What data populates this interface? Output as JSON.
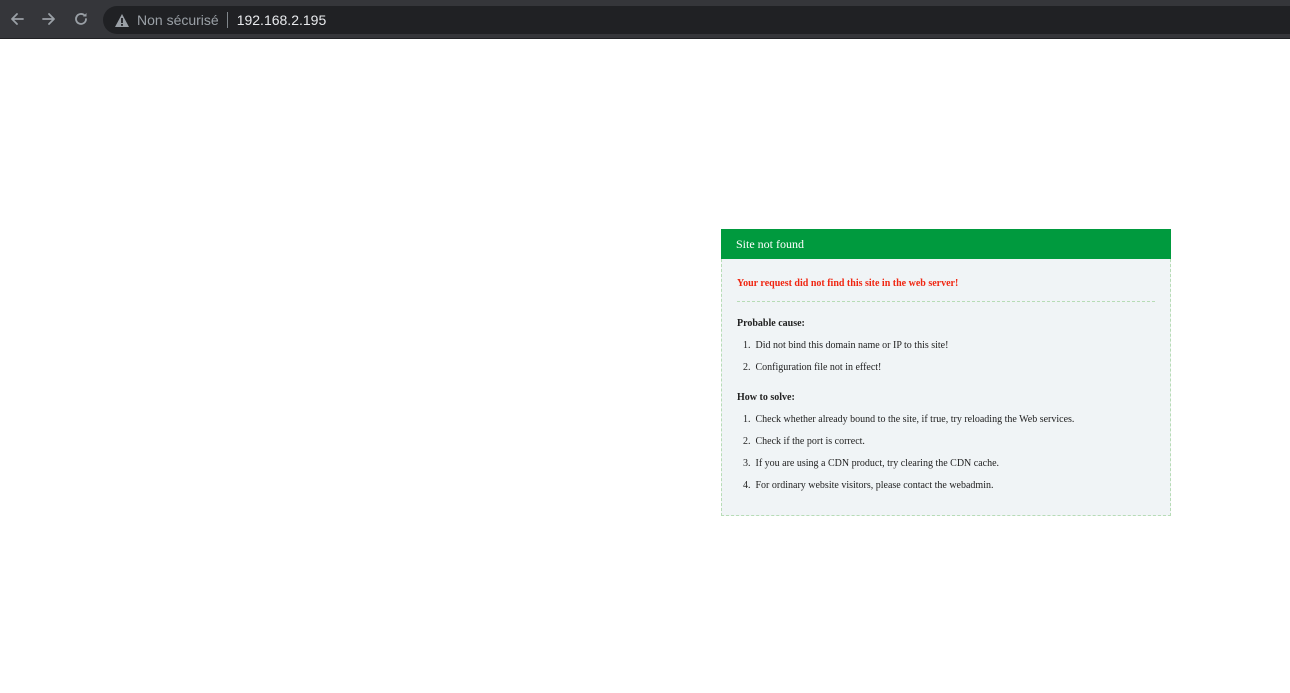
{
  "browser": {
    "security_label": "Non sécurisé",
    "url": "192.168.2.195",
    "icons": {
      "back": "arrow-left-icon",
      "forward": "arrow-right-icon",
      "reload": "reload-icon",
      "security": "warning-triangle-icon"
    }
  },
  "error": {
    "header": "Site not found",
    "message": "Your request did not find this site in the web server!",
    "cause_title": "Probable cause:",
    "causes": [
      {
        "num": "1.",
        "text": "Did not bind this domain name or IP to this site!"
      },
      {
        "num": "2.",
        "text": "Configuration file not in effect!"
      }
    ],
    "solve_title": "How to solve:",
    "solutions": [
      {
        "num": "1.",
        "text": "Check whether already bound to the site, if true, try reloading the Web services."
      },
      {
        "num": "2.",
        "text": "Check if the port is correct."
      },
      {
        "num": "3.",
        "text": "If you are using a CDN product, try clearing the CDN cache."
      },
      {
        "num": "4.",
        "text": "For ordinary website visitors, please contact the webadmin."
      }
    ]
  },
  "colors": {
    "chrome_background": "#35363a",
    "omnibox_background": "#202124",
    "header_green": "#009a3e",
    "message_red": "#f02611",
    "box_background": "#f0f4f6",
    "dashed_border": "#b7dcb6"
  }
}
